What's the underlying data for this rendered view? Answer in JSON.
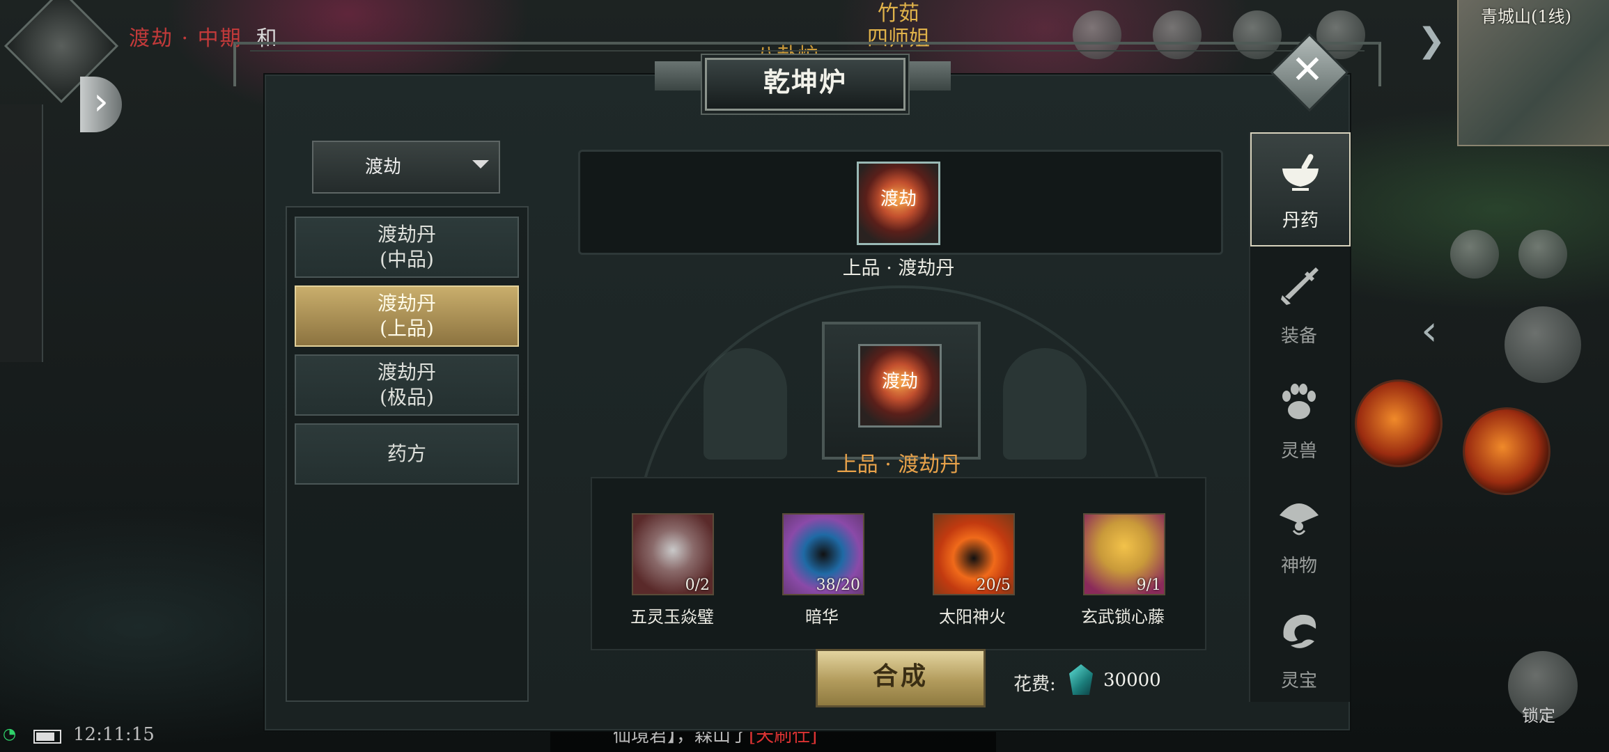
{
  "window": {
    "title": "乾坤炉"
  },
  "hud": {
    "status": "渡劫 · 中期",
    "mode": "和",
    "npc_line1": "竹茹",
    "npc_line2": "四师姐",
    "furnace_label": "八卦炉",
    "minimap_title": "青城山(1线)",
    "clock": "12:11:15",
    "lock_label": "锁定",
    "chat_text": "仙境君】，森山了",
    "chat_highlight": "[天刷仕]"
  },
  "sidebar": {
    "dropdown_value": "渡劫",
    "items": [
      {
        "line1": "渡劫丹",
        "line2": "(中品)",
        "selected": false
      },
      {
        "line1": "渡劫丹",
        "line2": "(上品)",
        "selected": true
      },
      {
        "line1": "渡劫丹",
        "line2": "(极品)",
        "selected": false
      },
      {
        "line1": "药方",
        "line2": "",
        "selected": false
      }
    ]
  },
  "crafting": {
    "top_item_glyph": "渡劫",
    "top_item_name": "上品 · 渡劫丹",
    "result_name": "上品 · 渡劫丹",
    "result_glyph": "渡劫",
    "materials": [
      {
        "name": "五灵玉焱璧",
        "count": "0/2",
        "color": "#5a2a2a"
      },
      {
        "name": "暗华",
        "count": "38/20",
        "color": "#6a3a7a"
      },
      {
        "name": "太阳神火",
        "count": "20/5",
        "color": "#7a3a18"
      },
      {
        "name": "玄武锁心藤",
        "count": "9/1",
        "color": "#8a2a5a"
      }
    ],
    "craft_button": "合成",
    "cost_label": "花费:",
    "cost_value": "30000"
  },
  "tabs": [
    {
      "label": "丹药",
      "icon": "mortar-pestle-icon",
      "active": true
    },
    {
      "label": "装备",
      "icon": "sword-icon",
      "active": false
    },
    {
      "label": "灵兽",
      "icon": "paw-icon",
      "active": false
    },
    {
      "label": "神物",
      "icon": "fan-icon",
      "active": false
    },
    {
      "label": "灵宝",
      "icon": "treasure-icon",
      "active": false
    }
  ],
  "colors": {
    "selected_item_gold": "#c9ae6c",
    "panel_bg": "#1f2929",
    "result_name_color": "#e8a24a",
    "status_red": "#c23a3a"
  }
}
